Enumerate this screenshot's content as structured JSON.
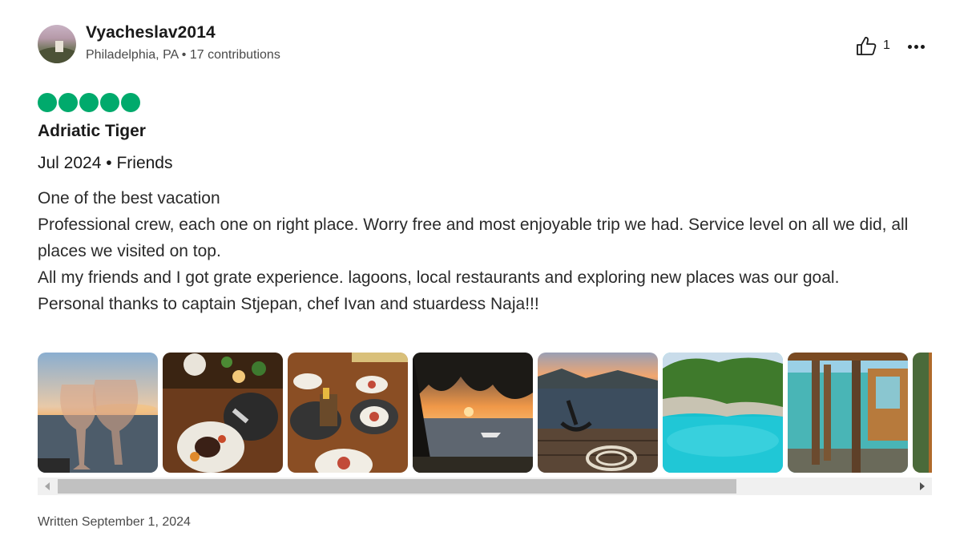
{
  "reviewer": {
    "name": "Vyacheslav2014",
    "location": "Philadelphia, PA",
    "separator": "•",
    "contributions": "17 contributions"
  },
  "actions": {
    "helpful_icon": "thumbs-up-icon",
    "helpful_count": "1",
    "more_icon": "ellipsis-icon"
  },
  "rating": {
    "value": 5,
    "max": 5,
    "color": "#00aa6c"
  },
  "review": {
    "title": "Adriatic Tiger",
    "trip_date": "Jul 2024",
    "trip_separator": "•",
    "trip_type": "Friends",
    "lines": [
      "One of the best vacation",
      "Professional crew, each one on right place. Worry free and most enjoyable trip we had. Service level on all we did, all places we visited on top.",
      "All my friends and I got grate experience. lagoons, local restaurants and exploring new places was our goal.",
      "Personal thanks to captain Stjepan, chef Ivan and stuardess Naja!!!"
    ]
  },
  "photos": [
    {
      "name": "photo-wine-glasses-sunset"
    },
    {
      "name": "photo-dinner-table-steak"
    },
    {
      "name": "photo-table-setting"
    },
    {
      "name": "photo-sunset-trees-boat"
    },
    {
      "name": "photo-anchor-on-deck"
    },
    {
      "name": "photo-turquoise-cove"
    },
    {
      "name": "photo-restaurant-terrace"
    },
    {
      "name": "photo-partial-next"
    }
  ],
  "scroll": {
    "visible_fraction": 0.76,
    "position": 0
  },
  "footer": {
    "written": "Written September 1, 2024"
  }
}
